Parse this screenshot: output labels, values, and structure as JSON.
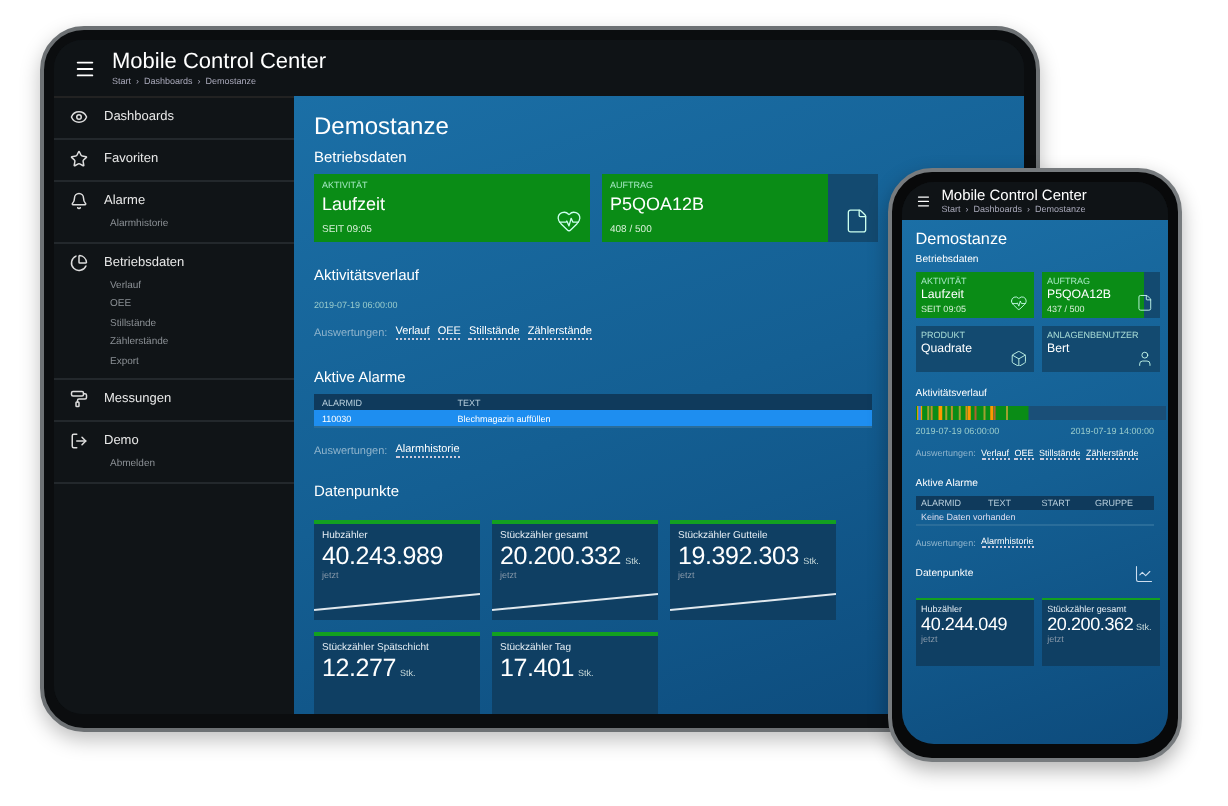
{
  "tablet": {
    "app_title": "Mobile Control Center",
    "breadcrumb": "Start  ›  Dashboards  ›  Demostanze",
    "sidebar": {
      "items": [
        {
          "label": "Dashboards"
        },
        {
          "label": "Favoriten"
        },
        {
          "label": "Alarme",
          "children": [
            {
              "label": "Alarmhistorie"
            }
          ]
        },
        {
          "label": "Betriebsdaten",
          "children": [
            {
              "label": "Verlauf"
            },
            {
              "label": "OEE"
            },
            {
              "label": "Stillstände"
            },
            {
              "label": "Zählerstände"
            },
            {
              "label": "Export"
            }
          ]
        },
        {
          "label": "Messungen"
        },
        {
          "label": "Demo",
          "children": [
            {
              "label": "Abmelden"
            }
          ]
        }
      ]
    },
    "page_title": "Demostanze",
    "section": "Betriebsdaten",
    "status_cards": [
      {
        "kind": "activity",
        "label": "AKTIVITÄT",
        "value": "Laufzeit",
        "detail": "SEIT  09:05"
      },
      {
        "kind": "order",
        "label": "AUFTRAG",
        "value": "P5QOA12B",
        "detail": "408 / 500",
        "level": 0.82
      }
    ],
    "activity": {
      "title": "Aktivitätsverlauf",
      "timestamps": [
        "2019-07-19 06:00:00"
      ],
      "evaluations_label": "Auswertungen:",
      "links": [
        "Verlauf",
        "OEE",
        "Stillstände",
        "Zählerstände"
      ]
    },
    "alarms": {
      "title": "Aktive Alarme",
      "columns": [
        "ALARMID",
        "TEXT"
      ],
      "rows": [
        {
          "cells": [
            "110030",
            "Blechmagazin auffüllen"
          ],
          "selected": true
        }
      ],
      "evaluations_label": "Auswertungen:",
      "links": [
        "Alarmhistorie"
      ]
    },
    "datapoints": {
      "title": "Datenpunkte",
      "items": [
        {
          "label": "Hubzähler",
          "value": "40.243.989",
          "time": "jetzt"
        },
        {
          "label": "Stückzähler gesamt",
          "value": "20.200.332",
          "unit": "Stk.",
          "time": "jetzt"
        },
        {
          "label": "Stückzähler Gutteile",
          "value": "19.392.303",
          "unit": "Stk.",
          "time": "jetzt"
        },
        {
          "label": "Stückzähler Spätschicht",
          "value": "12.277",
          "unit": "Stk."
        },
        {
          "label": "Stückzähler Tag",
          "value": "17.401",
          "unit": "Stk."
        }
      ]
    }
  },
  "phone": {
    "app_title": "Mobile Control Center",
    "breadcrumb": "Start  ›  Dashboards  ›  Demostanze",
    "page_title": "Demostanze",
    "section": "Betriebsdaten",
    "status_cards": [
      {
        "kind": "activity",
        "label": "AKTIVITÄT",
        "value": "Laufzeit",
        "detail": "SEIT  09:05"
      },
      {
        "kind": "order",
        "label": "AUFTRAG",
        "value": "P5QOA12B",
        "detail": "437 / 500",
        "level": 0.87
      },
      {
        "kind": "product",
        "label": "PRODUKT",
        "value": "Quadrate"
      },
      {
        "kind": "user",
        "label": "ANLAGENBENUTZER",
        "value": "Bert"
      }
    ],
    "activity": {
      "title": "Aktivitätsverlauf",
      "timestamps": [
        "2019-07-19 06:00:00",
        "2019-07-19 14:00:00"
      ],
      "evaluations_label": "Auswertungen:",
      "links": [
        "Verlauf",
        "OEE",
        "Stillstände",
        "Zählerstände"
      ]
    },
    "alarms": {
      "title": "Aktive Alarme",
      "columns": [
        "ALARMID",
        "TEXT",
        "START",
        "GRUPPE"
      ],
      "empty_text": "Keine Daten vorhanden",
      "evaluations_label": "Auswertungen:",
      "links": [
        "Alarmhistorie"
      ]
    },
    "datapoints": {
      "title": "Datenpunkte",
      "items": [
        {
          "label": "Hubzähler",
          "value": "40.244.049",
          "time": "jetzt"
        },
        {
          "label": "Stückzähler gesamt",
          "value": "20.200.362",
          "unit": "Stk.",
          "time": "jetzt"
        }
      ]
    }
  }
}
